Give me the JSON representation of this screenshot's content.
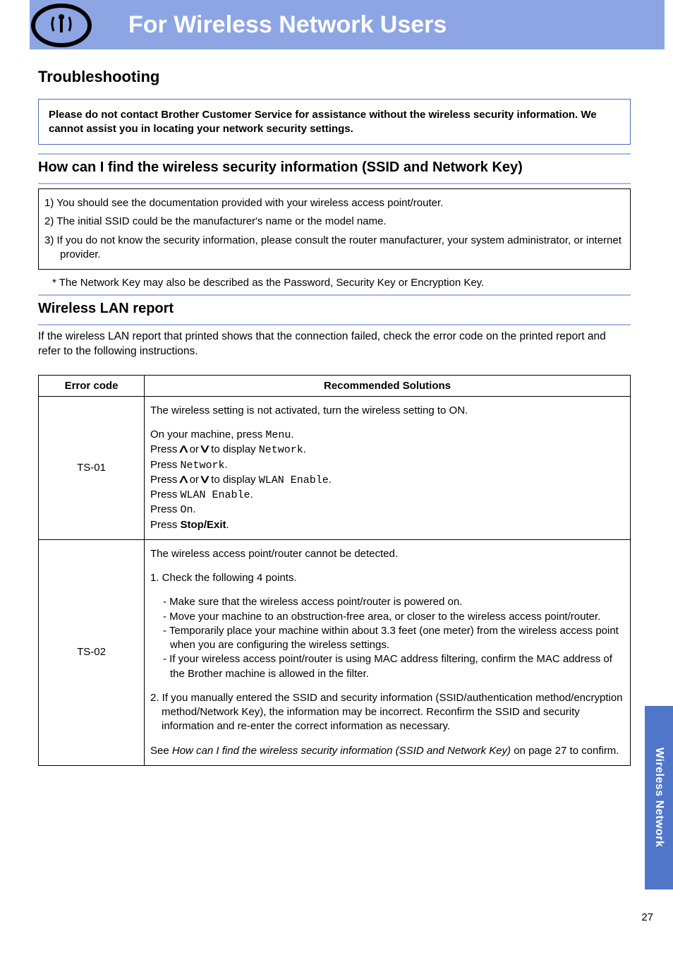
{
  "banner": {
    "title": "For Wireless Network Users"
  },
  "h_trouble": "Troubleshooting",
  "notice": "Please do not contact Brother Customer Service for assistance without the wireless security information. We cannot assist you in locating your network security settings.",
  "h_find": "How can I find the wireless security information (SSID and Network Key)",
  "find_items": {
    "i1": "1) You should see the documentation provided with your wireless access point/router.",
    "i2": "2) The initial SSID could be the manufacturer's name or the model name.",
    "i3": "3) If you do not know the security information, please consult the router manufacturer, your system administrator, or internet provider."
  },
  "footnote": "*  The Network Key may also be described as the Password, Security Key or Encryption Key.",
  "h_wlan": "Wireless LAN report",
  "wlan_intro": "If the wireless LAN report that printed shows that the connection failed, check the error code on the printed report and refer to the following instructions.",
  "table": {
    "th_code": "Error code",
    "th_sol": "Recommended Solutions",
    "rows": {
      "ts01": {
        "code": "TS-01",
        "intro": "The wireless setting is not activated, turn the wireless setting to ON.",
        "s1a": "On your machine, press ",
        "s1b": "Menu",
        "s1c": ".",
        "s2a": "Press ",
        "s2b": " or ",
        "s2c": " to display ",
        "s2d": "Network",
        "s2e": ".",
        "s3a": "Press ",
        "s3b": "Network",
        "s3c": ".",
        "s4a": "Press ",
        "s4b": " or ",
        "s4c": " to display ",
        "s4d": "WLAN Enable",
        "s4e": ".",
        "s5a": "Press ",
        "s5b": "WLAN Enable",
        "s5c": ".",
        "s6a": "Press ",
        "s6b": "On",
        "s6c": ".",
        "s7a": "Press ",
        "s7b": "Stop/Exit",
        "s7c": "."
      },
      "ts02": {
        "code": "TS-02",
        "intro": "The wireless access point/router cannot be detected.",
        "check": "1. Check the following 4 points.",
        "b1": "- Make sure that the wireless access point/router is powered on.",
        "b2": "- Move your machine to an obstruction-free area, or closer to the wireless access point/router.",
        "b3": "- Temporarily place your machine within about 3.3 feet (one meter) from the wireless access point when you are configuring the wireless settings.",
        "b4": "- If your wireless access point/router is using MAC address filtering, confirm the MAC address of the Brother machine is allowed in the filter.",
        "manual": "2. If you manually entered the SSID and security information (SSID/authentication method/encryption method/Network Key), the information may be incorrect. Reconfirm the SSID and security information and re-enter the correct information as necessary.",
        "see1": "See ",
        "see_it": "How can I find the wireless security information (SSID and Network Key)",
        "see2": " on page 27 to confirm."
      }
    }
  },
  "side_tab": "Wireless Network",
  "page_num": "27"
}
